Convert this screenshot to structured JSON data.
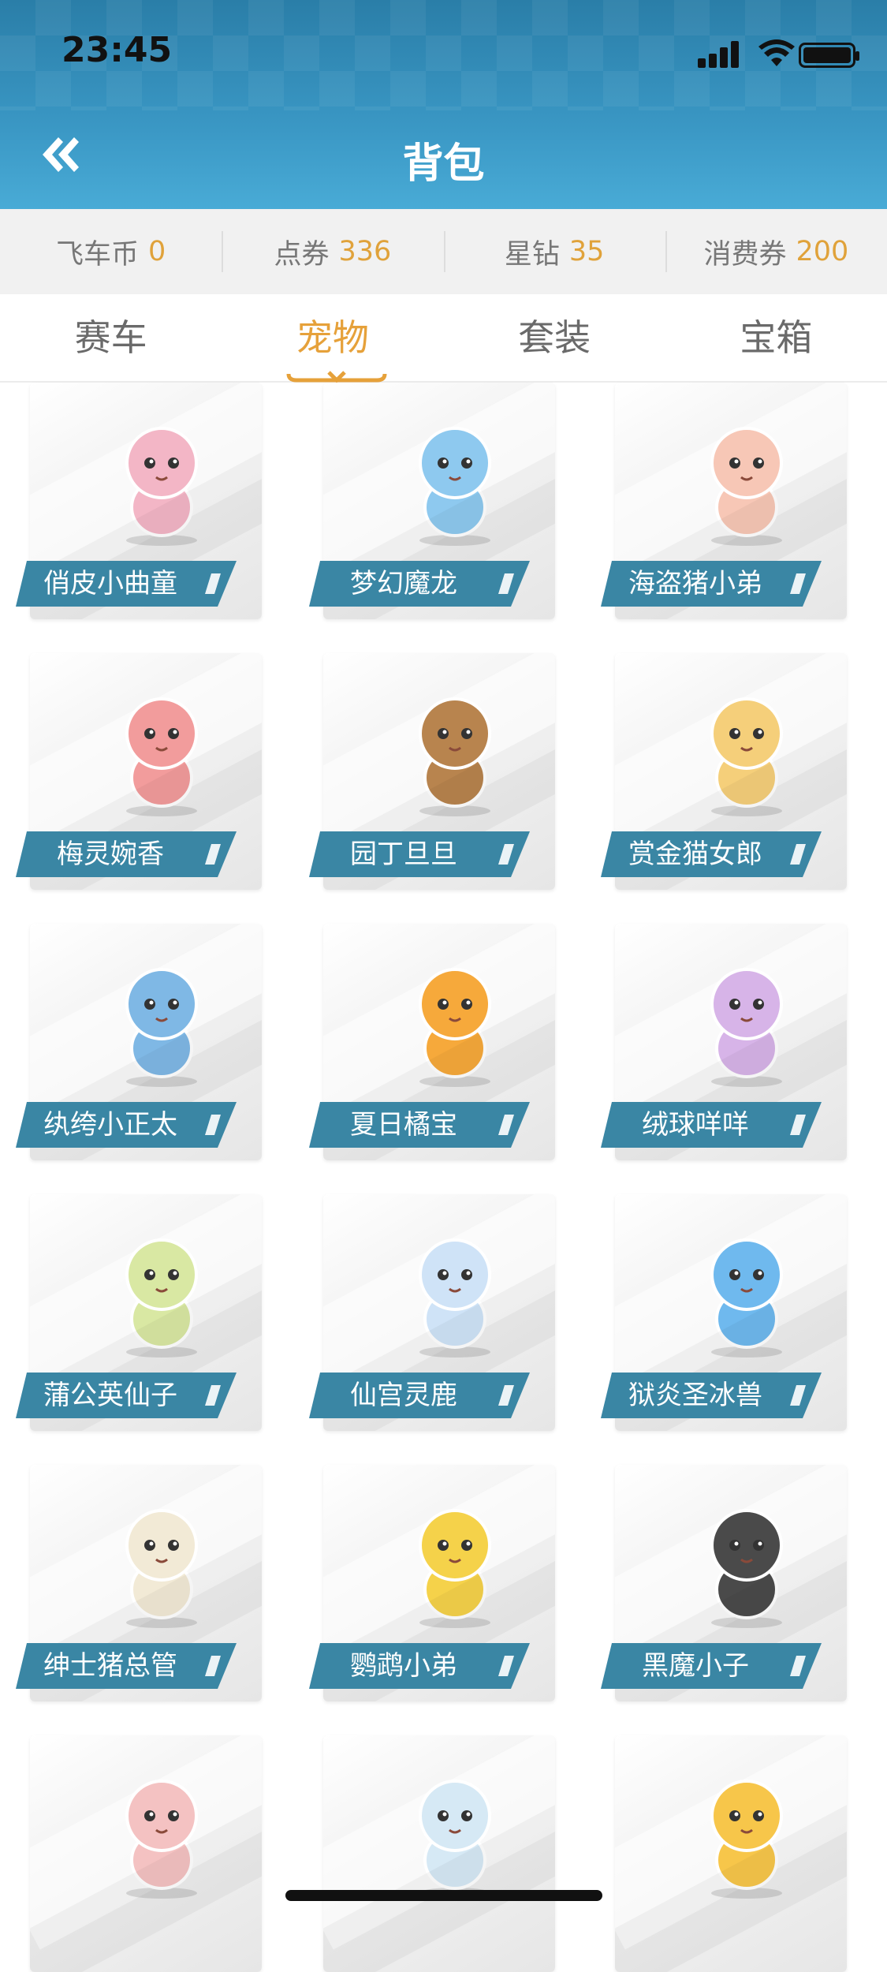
{
  "status_bar": {
    "time": "23:45"
  },
  "header": {
    "title": "背包",
    "back_icon": "double-chevron-left-icon"
  },
  "currencies": [
    {
      "label": "飞车币",
      "value": "0"
    },
    {
      "label": "点券",
      "value": "336"
    },
    {
      "label": "星钻",
      "value": "35"
    },
    {
      "label": "消费券",
      "value": "200"
    }
  ],
  "tabs": [
    {
      "label": "赛车",
      "active": false
    },
    {
      "label": "宠物",
      "active": true
    },
    {
      "label": "套装",
      "active": false
    },
    {
      "label": "宝箱",
      "active": false
    }
  ],
  "pets": [
    {
      "name": "俏皮小曲童",
      "color": "#f3b6c6"
    },
    {
      "name": "梦幻魔龙",
      "color": "#8ec9ef"
    },
    {
      "name": "海盗猪小弟",
      "color": "#f7c7b6"
    },
    {
      "name": "梅灵婉香",
      "color": "#f29c9c"
    },
    {
      "name": "园丁旦旦",
      "color": "#b8844e"
    },
    {
      "name": "赏金猫女郎",
      "color": "#f5cf7a"
    },
    {
      "name": "纨绔小正太",
      "color": "#7fb8e5"
    },
    {
      "name": "夏日橘宝",
      "color": "#f6a93b"
    },
    {
      "name": "绒球咩咩",
      "color": "#d7b4e8"
    },
    {
      "name": "蒲公英仙子",
      "color": "#d9e8a3"
    },
    {
      "name": "仙宫灵鹿",
      "color": "#cfe3f7"
    },
    {
      "name": "狱炎圣冰兽",
      "color": "#6fb9ee"
    },
    {
      "name": "绅士猪总管",
      "color": "#f2ead6"
    },
    {
      "name": "鹦鹉小弟",
      "color": "#f5d24a"
    },
    {
      "name": "黑魔小子",
      "color": "#4a4a4a"
    },
    {
      "name": "",
      "color": "#f4c2c2"
    },
    {
      "name": "",
      "color": "#d6e9f5"
    },
    {
      "name": "",
      "color": "#f7c64a"
    }
  ]
}
